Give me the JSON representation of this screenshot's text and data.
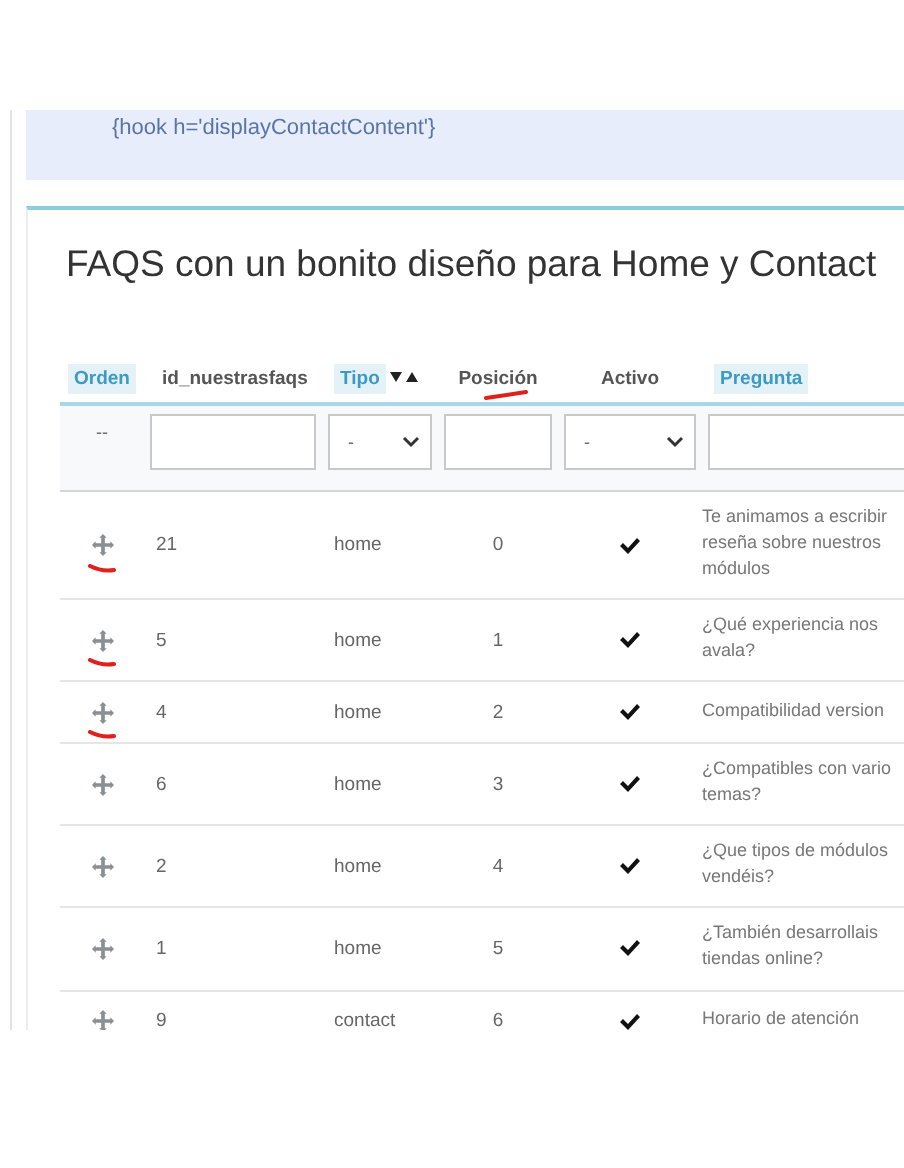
{
  "banner": {
    "code": "{hook h='displayContactContent'}"
  },
  "panel": {
    "title": "FAQS con un bonito diseño para Home y Contact"
  },
  "table": {
    "columns": [
      {
        "label": "Orden",
        "sortable": true,
        "sorted": false,
        "annotated": false
      },
      {
        "label": "id_nuestrasfaqs",
        "sortable": false,
        "sorted": false,
        "annotated": false
      },
      {
        "label": "Tipo",
        "sortable": true,
        "sorted": true,
        "annotated": false
      },
      {
        "label": "Posición",
        "sortable": false,
        "sorted": false,
        "annotated": true
      },
      {
        "label": "Activo",
        "sortable": false,
        "sorted": false,
        "annotated": false
      },
      {
        "label": "Pregunta",
        "sortable": true,
        "sorted": false,
        "annotated": false
      }
    ],
    "filters": [
      {
        "kind": "text",
        "value": "--"
      },
      {
        "kind": "input"
      },
      {
        "kind": "select",
        "value": "-"
      },
      {
        "kind": "input"
      },
      {
        "kind": "select",
        "value": "-"
      },
      {
        "kind": "input"
      }
    ],
    "rows": [
      {
        "id": "21",
        "tipo": "home",
        "posicion": "0",
        "activo": true,
        "pregunta": "Te animamos a escribir\nreseña sobre nuestros\nmódulos",
        "annotated": true
      },
      {
        "id": "5",
        "tipo": "home",
        "posicion": "1",
        "activo": true,
        "pregunta": "¿Qué experiencia nos\navala?",
        "annotated": true
      },
      {
        "id": "4",
        "tipo": "home",
        "posicion": "2",
        "activo": true,
        "pregunta": "Compatibilidad version",
        "annotated": true
      },
      {
        "id": "6",
        "tipo": "home",
        "posicion": "3",
        "activo": true,
        "pregunta": "¿Compatibles con vario\ntemas?",
        "annotated": false
      },
      {
        "id": "2",
        "tipo": "home",
        "posicion": "4",
        "activo": true,
        "pregunta": "¿Que tipos de módulos\nvendéis?",
        "annotated": false
      },
      {
        "id": "1",
        "tipo": "home",
        "posicion": "5",
        "activo": true,
        "pregunta": "¿También desarrollais\ntiendas online?",
        "annotated": false
      },
      {
        "id": "9",
        "tipo": "contact",
        "posicion": "6",
        "activo": true,
        "pregunta": "Horario de atención",
        "annotated": false
      }
    ]
  }
}
